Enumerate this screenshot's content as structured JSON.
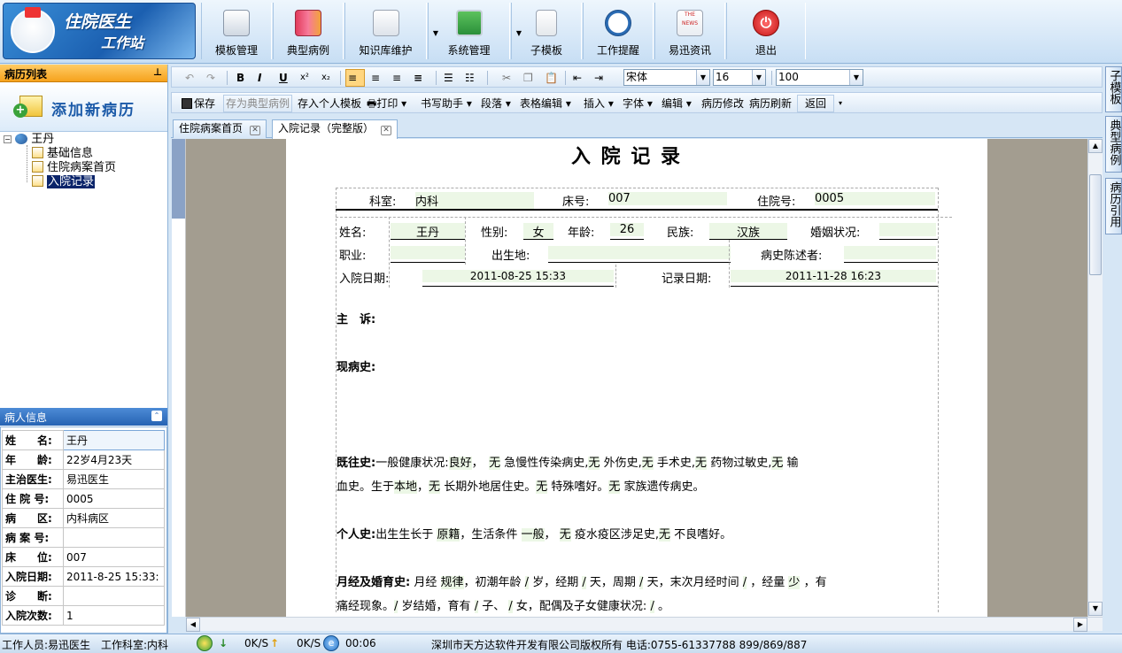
{
  "app": {
    "logo_line1": "住院医生",
    "logo_line2": "工作站"
  },
  "top_toolbar": [
    {
      "label": "模板管理",
      "icon": "template-pencil-icon"
    },
    {
      "label": "典型病例",
      "icon": "books-icon"
    },
    {
      "label": "知识库维护",
      "icon": "documents-icon"
    },
    {
      "label": "系统管理",
      "icon": "monitor-icon"
    },
    {
      "label": "子模板",
      "icon": "document-icon"
    },
    {
      "label": "工作提醒",
      "icon": "clock-icon"
    },
    {
      "label": "易迅资讯",
      "icon": "newspaper-icon",
      "badge": "THE NEWS"
    },
    {
      "label": "退出",
      "icon": "power-icon"
    }
  ],
  "left": {
    "record_list_title": "病历列表",
    "add_new_label": "添加新病历",
    "tree": {
      "patient": "王丹",
      "items": [
        "基础信息",
        "住院病案首页",
        "入院记录"
      ],
      "selected": "入院记录"
    },
    "patient_info_title": "病人信息",
    "patient_info": [
      {
        "k": "姓　　名:",
        "v": "王丹"
      },
      {
        "k": "年　　龄:",
        "v": "22岁4月23天"
      },
      {
        "k": "主治医生:",
        "v": "易迅医生"
      },
      {
        "k": "住 院 号:",
        "v": "0005"
      },
      {
        "k": "病　　区:",
        "v": "内科病区"
      },
      {
        "k": "病 案 号:",
        "v": ""
      },
      {
        "k": "床　　位:",
        "v": "007"
      },
      {
        "k": "入院日期:",
        "v": "2011-8-25 15:33:"
      },
      {
        "k": "诊　　断:",
        "v": ""
      },
      {
        "k": "入院次数:",
        "v": "1"
      }
    ]
  },
  "format_toolbar": {
    "undo": "↶",
    "redo": "↷",
    "bold": "B",
    "italic": "I",
    "underline": "U",
    "superscript": "x²",
    "subscript": "x₂",
    "font_family": "宋体",
    "font_size": "16",
    "zoom": "100"
  },
  "action_toolbar": {
    "save": "保存",
    "save_typical": "存为典型病例",
    "save_personal": "存入个人模板",
    "print": "打印",
    "writing_helper": "书写助手",
    "paragraph": "段落",
    "table_edit": "表格编辑",
    "insert": "插入",
    "font": "字体",
    "edit": "编辑",
    "modify": "病历修改",
    "refresh": "病历刷新",
    "back": "返回"
  },
  "tabs": [
    {
      "label": "住院病案首页",
      "active": false
    },
    {
      "label": "入院记录（完整版）",
      "active": true
    }
  ],
  "document": {
    "title": "入 院 记 录",
    "header": {
      "dept_label": "科室:",
      "dept": "内科",
      "bed_label": "床号:",
      "bed": "007",
      "inpatient_label": "住院号:",
      "inpatient": "0005"
    },
    "info": {
      "name_label": "姓名:",
      "name": "王丹",
      "sex_label": "性别:",
      "sex": "女",
      "age_label": "年龄:",
      "age": "26",
      "ethnic_label": "民族:",
      "ethnic": "汉族",
      "marital_label": "婚姻状况:",
      "job_label": "职业:",
      "birthplace_label": "出生地:",
      "narrator_label": "病史陈述者:",
      "admit_label": "入院日期:",
      "admit": "2011-08-25 15:33",
      "record_label": "记录日期:",
      "record": "2011-11-28 16:23"
    },
    "chief_complaint": "主　诉:",
    "present_illness": "现病史:",
    "past_history": {
      "label": "既往史:",
      "t1": "一般健康状况:",
      "f1": "良好",
      "t2": "，",
      "f2": "无",
      "t3": "急慢性传染病史,",
      "f3": "无",
      "t4": "外伤史,",
      "f4": "无",
      "t5": "手术史,",
      "f5": "无",
      "t6": "药物过敏史,",
      "f6": "无",
      "t7": "输",
      "l2a": "血史。生于",
      "l2f1": "本地",
      "l2b": "，",
      "l2f2": "无",
      "l2c": "长期外地居住史。",
      "l2f3": "无",
      "l2d": "特殊嗜好。",
      "l2f4": "无",
      "l2e": "家族遗传病史。"
    },
    "personal_history": {
      "label": "个人史:",
      "t1": "出生生长于",
      "f1": "原籍",
      "t2": "，生活条件",
      "f2": "一般",
      "t3": "，",
      "f3": "无",
      "t4": "疫水疫区涉足史,",
      "f4": "无",
      "t5": "不良嗜好。"
    },
    "menstrual_history": {
      "label": "月经及婚育史:",
      "t1": "月经",
      "f1": "规律",
      "t2": "，初潮年龄",
      "f2": "/",
      "t3": "岁，经期",
      "f3": "/",
      "t4": "天，周期",
      "f4": "/",
      "t5": "天，末次月经时间",
      "f5": "/",
      "t6": "，经量",
      "f6": "少",
      "t7": "，有",
      "l2a": "痛经现象。",
      "l2f1": "/",
      "l2b": "岁结婚，育有",
      "l2f2": "/",
      "l2c": "子、",
      "l2f3": "/",
      "l2d": "女，配偶及子女健康状况:",
      "l2f4": "/",
      "l2e": "。"
    }
  },
  "right_tabs": [
    "子模板",
    "典型病例",
    "病历引用"
  ],
  "status": {
    "operator": "工作人员:易迅医生",
    "dept": "工作科室:内科",
    "down": "0K/S",
    "up": "0K/S",
    "timer": "00:06",
    "copyright": "深圳市天方达软件开发有限公司版权所有 电话:0755-61337788 899/869/887"
  }
}
